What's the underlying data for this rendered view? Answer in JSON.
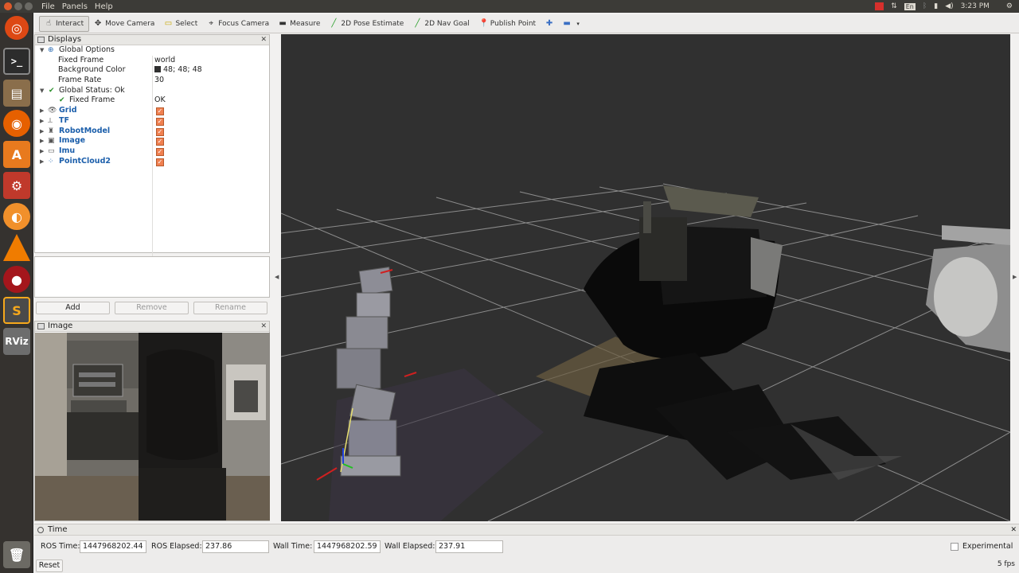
{
  "menubar": {
    "menus": [
      "File",
      "Panels",
      "Help"
    ],
    "keyboard_layout": "En",
    "clock": "3:23 PM"
  },
  "toolbar": {
    "tools": [
      {
        "label": "Interact",
        "icon": "interact-icon",
        "active": true
      },
      {
        "label": "Move Camera",
        "icon": "move-camera-icon"
      },
      {
        "label": "Select",
        "icon": "select-icon"
      },
      {
        "label": "Focus Camera",
        "icon": "focus-camera-icon"
      },
      {
        "label": "Measure",
        "icon": "measure-icon"
      },
      {
        "label": "2D Pose Estimate",
        "icon": "pose-arrow-icon"
      },
      {
        "label": "2D Nav Goal",
        "icon": "nav-goal-arrow-icon"
      },
      {
        "label": "Publish Point",
        "icon": "map-pin-icon"
      }
    ]
  },
  "displays": {
    "title": "Displays",
    "global_options": {
      "label": "Global Options",
      "fixed_frame_label": "Fixed Frame",
      "fixed_frame_value": "world",
      "background_color_label": "Background Color",
      "background_color_value": "48; 48; 48",
      "frame_rate_label": "Frame Rate",
      "frame_rate_value": "30"
    },
    "global_status": {
      "label": "Global Status: Ok",
      "fixed_frame_label": "Fixed Frame",
      "fixed_frame_value": "OK"
    },
    "items": [
      {
        "label": "Grid",
        "checked": true
      },
      {
        "label": "TF",
        "checked": true
      },
      {
        "label": "RobotModel",
        "checked": true
      },
      {
        "label": "Image",
        "checked": true
      },
      {
        "label": "Imu",
        "checked": true
      },
      {
        "label": "PointCloud2",
        "checked": true
      }
    ],
    "buttons": {
      "add": "Add",
      "remove": "Remove",
      "rename": "Rename"
    }
  },
  "image_panel": {
    "title": "Image"
  },
  "time_panel": {
    "title": "Time",
    "ros_time_label": "ROS Time:",
    "ros_time_value": "1447968202.44",
    "ros_elapsed_label": "ROS Elapsed:",
    "ros_elapsed_value": "237.86",
    "wall_time_label": "Wall Time:",
    "wall_time_value": "1447968202.59",
    "wall_elapsed_label": "Wall Elapsed:",
    "wall_elapsed_value": "237.91",
    "experimental_label": "Experimental",
    "experimental_checked": false,
    "reset_label": "Reset",
    "fps": "5 fps"
  },
  "colors": {
    "render_background": "#303030",
    "panel_accent": "#1c5fab",
    "checkbox": "#f08050"
  }
}
